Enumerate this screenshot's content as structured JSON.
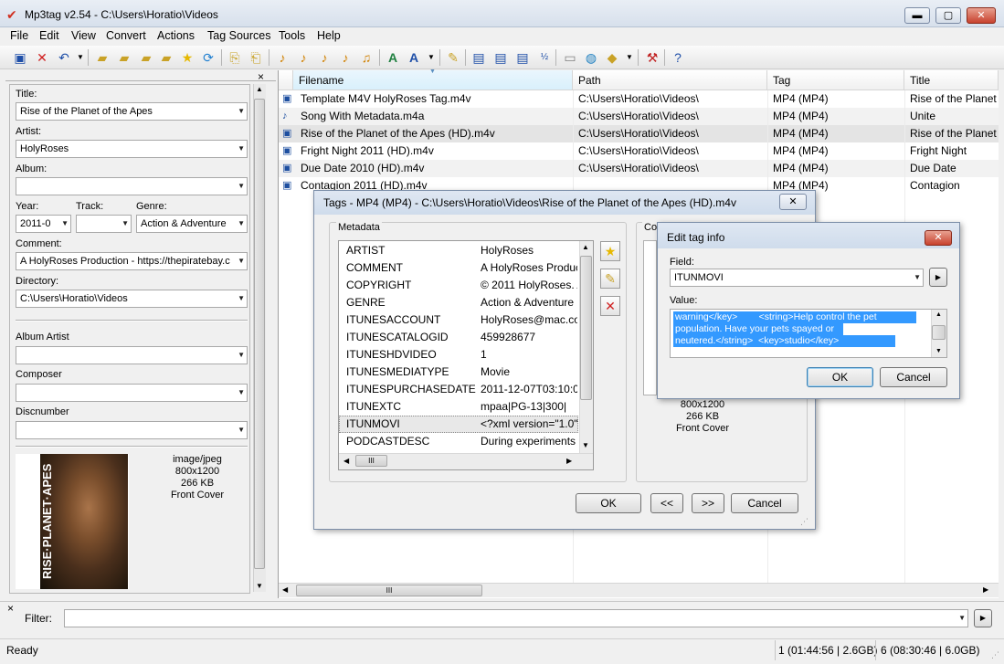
{
  "window": {
    "title": "Mp3tag v2.54  -  C:\\Users\\Horatio\\Videos",
    "minimize": "▬",
    "maximize": "▢",
    "close": "✕"
  },
  "menu": [
    "File",
    "Edit",
    "View",
    "Convert",
    "Actions",
    "Tag Sources",
    "Tools",
    "Help"
  ],
  "toolbar_icons": [
    "save-icon",
    "remove-tag-icon",
    "undo-icon",
    "dropdown-icon",
    "open-dir-icon",
    "add-dir-icon",
    "add-files-icon",
    "favorites-icon",
    "star-icon",
    "refresh-icon",
    "copy-tag-icon",
    "paste-tag-icon",
    "tag-filename-icon",
    "filename-tag-icon",
    "filename-filename-icon",
    "text-file-tag-icon",
    "tag-source-icon",
    "case-icon",
    "dropdown-icon",
    "extended-tags-icon",
    "export-icon",
    "playlist-icon",
    "numbering-icon",
    "play-icon",
    "web-icon",
    "actions-icon",
    "dropdown-icon",
    "options-icon",
    "help-icon"
  ],
  "panel": {
    "close": "×",
    "title_label": "Title:",
    "title_value": "Rise of the Planet of the Apes",
    "artist_label": "Artist:",
    "artist_value": "HolyRoses",
    "album_label": "Album:",
    "album_value": "",
    "year_label": "Year:",
    "year_value": "2011-0",
    "track_label": "Track:",
    "track_value": "",
    "genre_label": "Genre:",
    "genre_value": "Action & Adventure",
    "comment_label": "Comment:",
    "comment_value": "A HolyRoses Production - https://thepiratebay.c",
    "directory_label": "Directory:",
    "directory_value": "C:\\Users\\Horatio\\Videos",
    "album_artist_label": "Album Artist",
    "composer_label": "Composer",
    "discnumber_label": "Discnumber",
    "cover_title": "RISE·PLANET·APES",
    "cover_type": "image/jpeg",
    "cover_dims": "800x1200",
    "cover_size": "266 KB",
    "cover_kind": "Front Cover"
  },
  "filelist": {
    "columns": [
      "Filename",
      "Path",
      "Tag",
      "Title"
    ],
    "rows": [
      {
        "filename": "Template M4V HolyRoses Tag.m4v",
        "path": "C:\\Users\\Horatio\\Videos\\",
        "tag": "MP4 (MP4)",
        "title": "Rise of the Planet"
      },
      {
        "filename": "Song With Metadata.m4a",
        "path": "C:\\Users\\Horatio\\Videos\\",
        "tag": "MP4 (MP4)",
        "title": "Unite"
      },
      {
        "filename": "Rise of the Planet of the Apes (HD).m4v",
        "path": "C:\\Users\\Horatio\\Videos\\",
        "tag": "MP4 (MP4)",
        "title": "Rise of the Planet"
      },
      {
        "filename": "Fright Night 2011 (HD).m4v",
        "path": "C:\\Users\\Horatio\\Videos\\",
        "tag": "MP4 (MP4)",
        "title": "Fright Night"
      },
      {
        "filename": "Due Date 2010 (HD).m4v",
        "path": "C:\\Users\\Horatio\\Videos\\",
        "tag": "MP4 (MP4)",
        "title": "Due Date"
      },
      {
        "filename": "Contagion 2011 (HD).m4v",
        "path": "",
        "tag": "MP4 (MP4)",
        "title": "Contagion"
      }
    ],
    "hscroll_grip": "III"
  },
  "filter": {
    "label": "Filter:",
    "value": ""
  },
  "status": {
    "left": "Ready",
    "selected": "1 (01:44:56 | 2.6GB)",
    "total": "6 (08:30:46 | 6.0GB)"
  },
  "tags_dialog": {
    "title": "Tags - MP4 (MP4) - C:\\Users\\Horatio\\Videos\\Rise of the Planet of the Apes (HD).m4v",
    "close": "✕",
    "metadata_label": "Metadata",
    "cover_label": "Co",
    "rows": [
      {
        "field": "ARTIST",
        "value": "HolyRoses"
      },
      {
        "field": "COMMENT",
        "value": "A HolyRoses Produc"
      },
      {
        "field": "COPYRIGHT",
        "value": "© 2011 HolyRoses. A"
      },
      {
        "field": "GENRE",
        "value": "Action & Adventure"
      },
      {
        "field": "ITUNESACCOUNT",
        "value": "HolyRoses@mac.co"
      },
      {
        "field": "ITUNESCATALOGID",
        "value": "459928677"
      },
      {
        "field": "ITUNESHDVIDEO",
        "value": "1"
      },
      {
        "field": "ITUNESMEDIATYPE",
        "value": "Movie"
      },
      {
        "field": "ITUNESPURCHASEDATE",
        "value": "2011-12-07T03:10:07"
      },
      {
        "field": "ITUNEXTC",
        "value": "mpaa|PG-13|300|"
      },
      {
        "field": "ITUNMOVI",
        "value": "<?xml version=\"1.0\""
      },
      {
        "field": "PODCASTDESC",
        "value": "During experiments"
      }
    ],
    "hscroll_grip": "III",
    "cover_dims": "800x1200",
    "cover_size": "266 KB",
    "cover_kind": "Front Cover",
    "ok": "OK",
    "prev": "<<",
    "next": ">>",
    "cancel": "Cancel"
  },
  "edit_dialog": {
    "title": "Edit tag info",
    "field_label": "Field:",
    "field_value": "ITUNMOVI",
    "value_label": "Value:",
    "value_lines": [
      "warning</key>        <string>Help control the pet",
      "population. Have your pets spayed or",
      "neutered.</string>  <key>studio</key>"
    ],
    "ok": "OK",
    "cancel": "Cancel"
  }
}
